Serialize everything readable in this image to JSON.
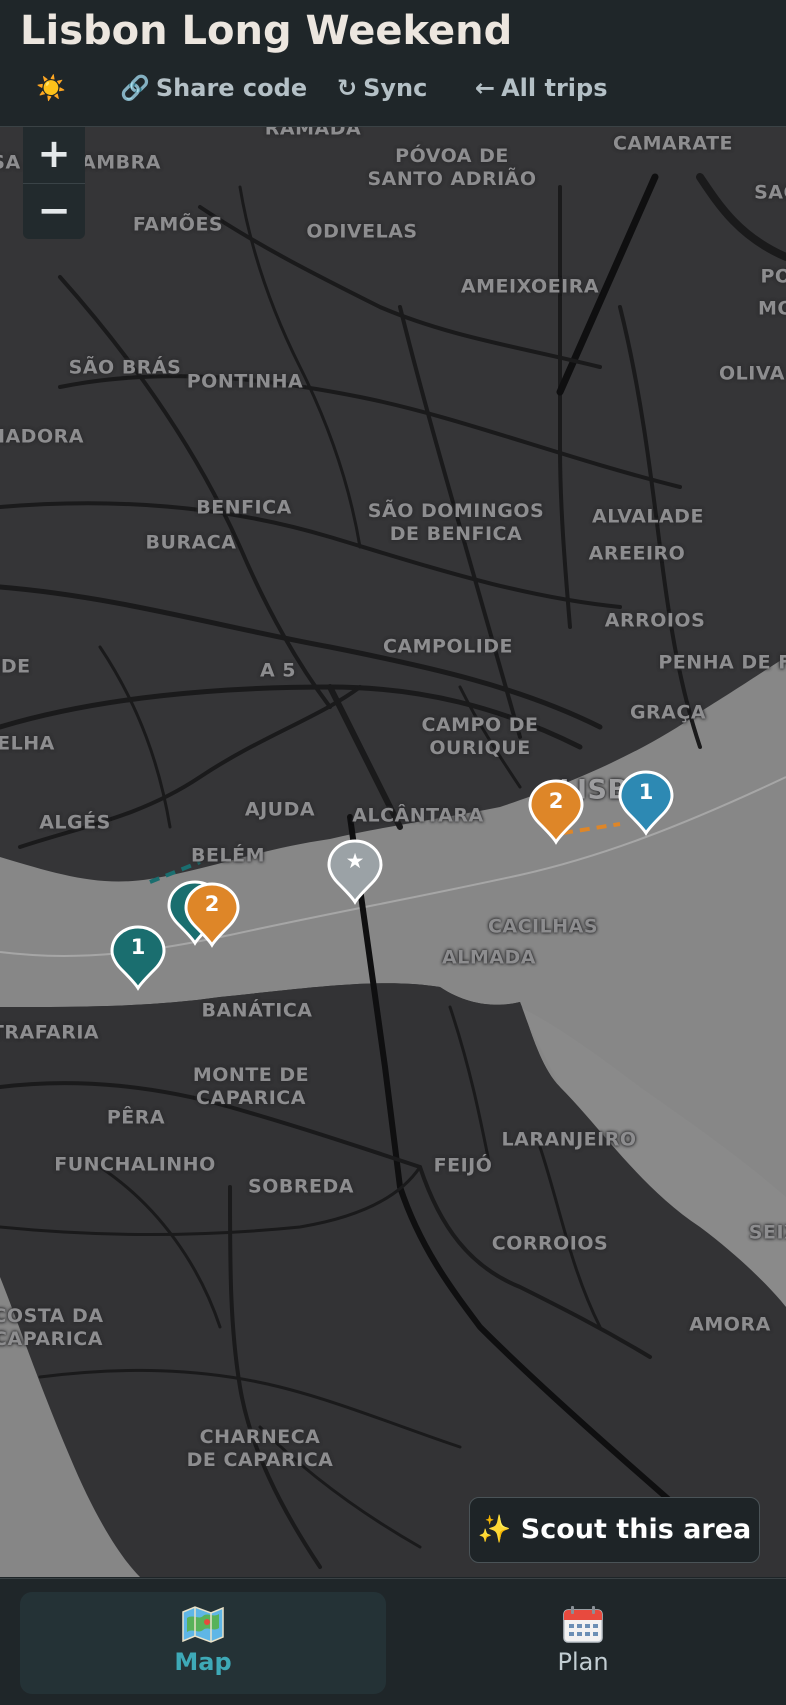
{
  "header": {
    "title": "Lisbon Long Weekend",
    "toolbar": {
      "theme_icon": "☀️",
      "share_icon": "🔗",
      "share_label": "Share code",
      "sync_icon": "↻",
      "sync_label": "Sync",
      "back_icon": "←",
      "all_trips_label": "All trips"
    }
  },
  "map": {
    "zoom_in_label": "+",
    "zoom_out_label": "−",
    "place_labels": [
      "RAMADA",
      "PÓVOA DE\nSANTO ADRIÃO",
      "CAMARATE",
      "SAC",
      "AMBRA",
      "SA",
      "FAMÕES",
      "ODIVELAS",
      "AMEIXOEIRA",
      "PO",
      "MO",
      "OLIVA",
      "SÃO BRÁS",
      "PONTINHA",
      "MADORA",
      "BENFICA",
      "SÃO DOMINGOS\nDE BENFICA",
      "ALVALADE",
      "BURACA",
      "AREEIRO",
      "ARROIOS",
      "CAMPOLIDE",
      "PENHA DE F",
      "IDE",
      "GRAÇA",
      "ELHA",
      "CAMPO DE\nOURIQUE",
      "LISBOA",
      "AJUDA",
      "ALCÂNTARA",
      "ALGÉS",
      "BELÉM",
      "CACILHAS",
      "ALMADA",
      "BANÁTICA",
      "TRAFARIA",
      "MONTE DE\nCAPARICA",
      "PÊRA",
      "LARANJEIRO",
      "FUNCHALINHO",
      "FEIJÓ",
      "SOBREDA",
      "COSTA DA\nCAPARICA",
      "CORROIOS",
      "SEIX",
      "CHARNECA\nDE CAPARICA",
      "AMORA",
      "A 5"
    ],
    "markers": [
      {
        "label": "1",
        "color": "#1a6e6f",
        "icon": "numbered-pin"
      },
      {
        "label": "2",
        "color": "#de8628",
        "icon": "numbered-pin"
      },
      {
        "label": "1",
        "color": "#2d89b3",
        "icon": "numbered-pin"
      },
      {
        "label": "2",
        "color": "#de8628",
        "icon": "numbered-pin"
      },
      {
        "label": "★",
        "color": "#9ba2a6",
        "icon": "star-pin"
      },
      {
        "label": "",
        "color": "#1a6e6f",
        "icon": "numbered-pin"
      }
    ],
    "scout_button": "✨ Scout this area"
  },
  "bottom_nav": {
    "map_label": "Map",
    "plan_label": "Plan"
  },
  "colors": {
    "teal_accent": "#3ea9b7",
    "orange_route": "#de8628",
    "blue_route": "#2d89b3",
    "teal_route": "#1a6e6f"
  }
}
